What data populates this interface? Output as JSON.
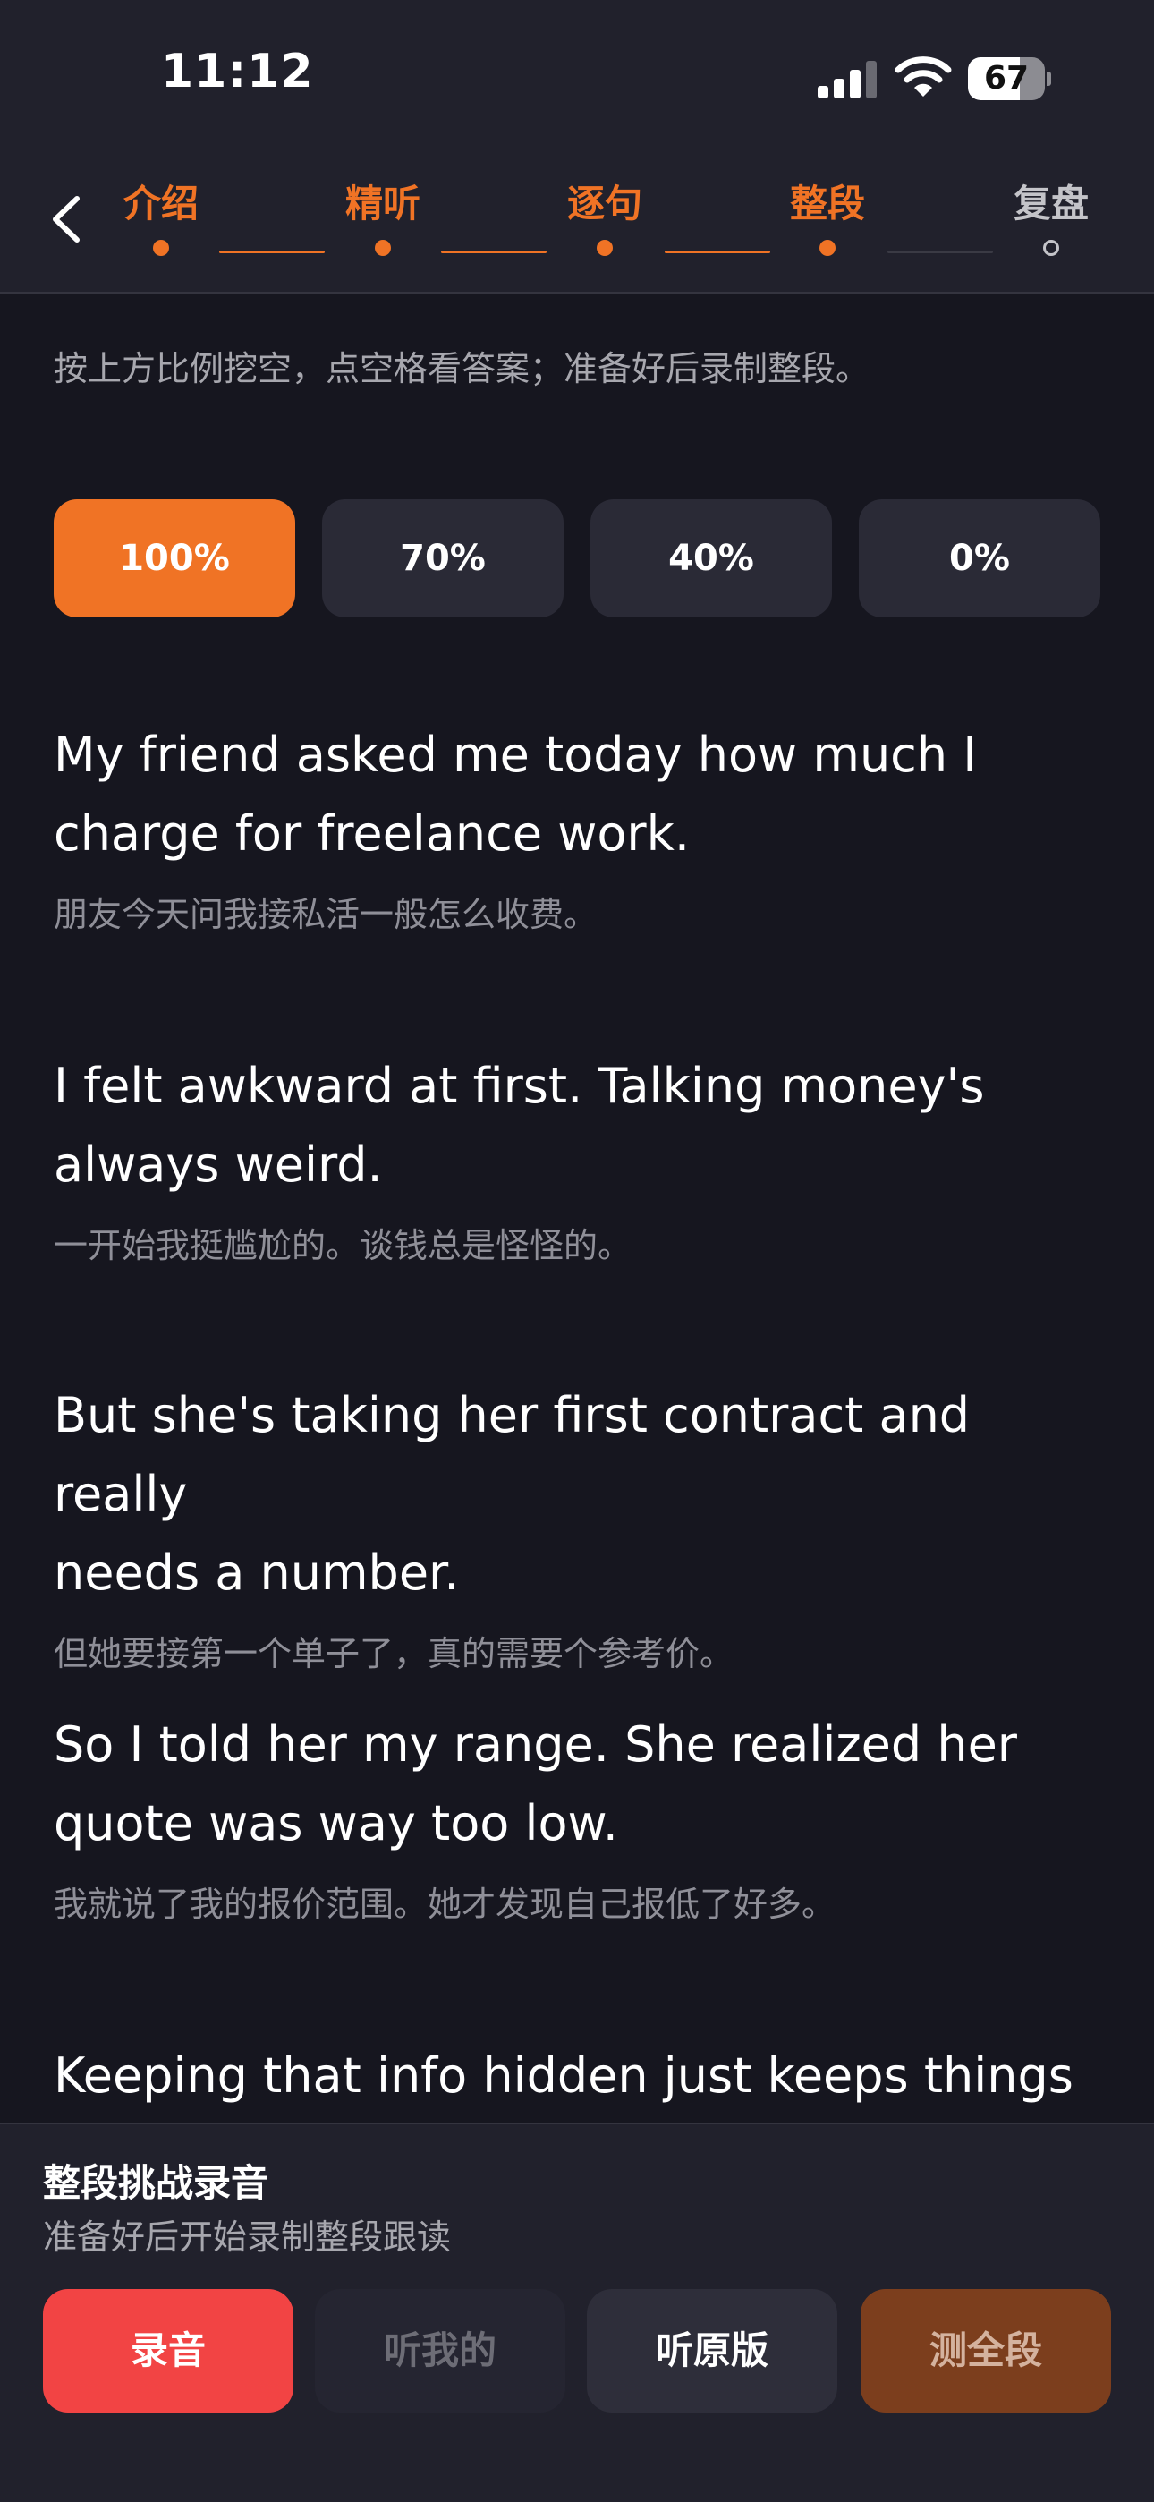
{
  "status_bar": {
    "time": "11:12",
    "battery": "67",
    "battery_level": 0.67,
    "icons": [
      "cellular-signal-icon",
      "wifi-icon",
      "battery-icon"
    ]
  },
  "nav": {
    "back_icon": "chevron-left-icon",
    "steps": [
      {
        "label": "介绍",
        "state": "done"
      },
      {
        "label": "精听",
        "state": "done"
      },
      {
        "label": "逐句",
        "state": "done"
      },
      {
        "label": "整段",
        "state": "current"
      },
      {
        "label": "复盘",
        "state": "todo"
      }
    ]
  },
  "main": {
    "instruction": "按上方比例挖空，点空格看答案；准备好后录制整段。",
    "ratios": [
      {
        "label": "100%",
        "selected": true
      },
      {
        "label": "70%",
        "selected": false
      },
      {
        "label": "40%",
        "selected": false
      },
      {
        "label": "0%",
        "selected": false
      }
    ],
    "sentences": [
      {
        "en_line1": "My friend asked me today how much I",
        "en_line2": "charge for freelance work.",
        "zh": "朋友今天问我接私活一般怎么收费。"
      },
      {
        "en_line1": "I felt awkward at first. Talking money's",
        "en_line2": "always weird.",
        "zh": "一开始我挺尴尬的。谈钱总是怪怪的。"
      },
      {
        "en_line1": "But she's taking her first contract and really",
        "en_line2": "needs a number.",
        "zh": "但她要接第一个单子了，真的需要个参考价。"
      },
      {
        "en_line1": "So I told her my range. She realized her",
        "en_line2": "quote was way too low.",
        "zh": "我就说了我的报价范围。她才发现自己报低了好多。"
      },
      {
        "en_line1": "Keeping that info hidden just keeps things",
        "en_line2": "",
        "zh": ""
      }
    ]
  },
  "bottom_panel": {
    "title": "整段挑战录音",
    "subtitle": "准备好后开始录制整段跟读",
    "buttons": {
      "record": "录音",
      "listen_mine": "听我的",
      "listen_original": "听原版",
      "test_full": "测全段"
    }
  },
  "colors": {
    "accent": "#f07325",
    "record": "#f24444",
    "background": "#16161f",
    "panel": "#21212c"
  }
}
